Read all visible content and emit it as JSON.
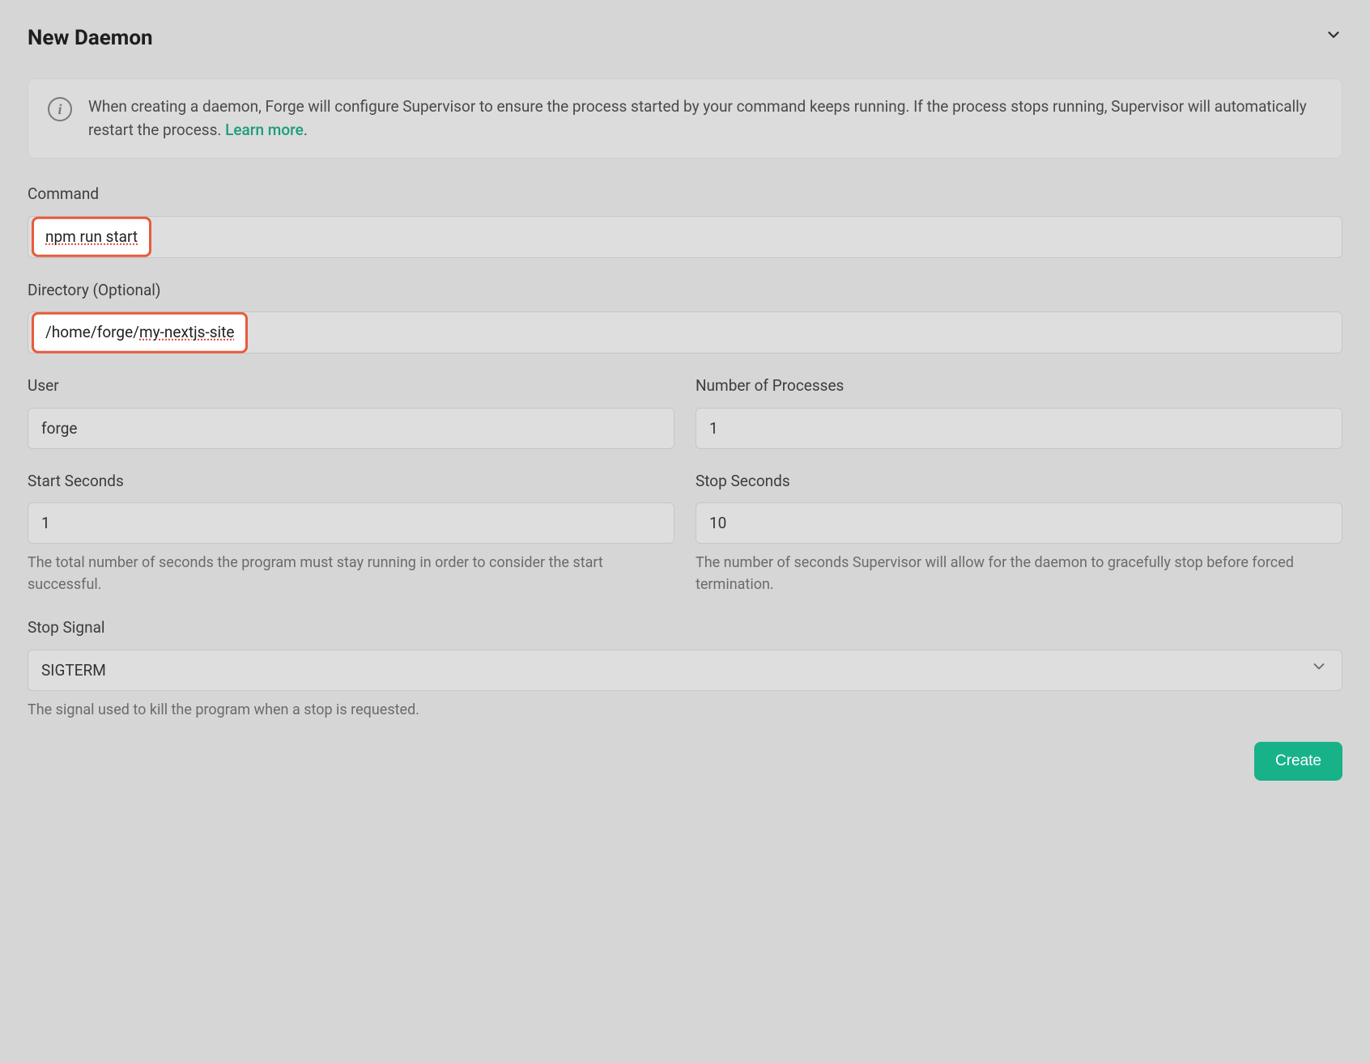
{
  "header": {
    "title": "New Daemon"
  },
  "info": {
    "text": "When creating a daemon, Forge will configure Supervisor to ensure the process started by your command keeps running. If the process stops running, Supervisor will automatically restart the process. ",
    "learn_more": "Learn more"
  },
  "fields": {
    "command": {
      "label": "Command",
      "value": "npm run start"
    },
    "directory": {
      "label": "Directory (Optional)",
      "value_prefix": "/home/forge/",
      "value_suffix": "my-nextjs-site"
    },
    "user": {
      "label": "User",
      "value": "forge"
    },
    "num_processes": {
      "label": "Number of Processes",
      "value": "1"
    },
    "start_seconds": {
      "label": "Start Seconds",
      "value": "1",
      "help": "The total number of seconds the program must stay running in order to consider the start successful."
    },
    "stop_seconds": {
      "label": "Stop Seconds",
      "value": "10",
      "help": "The number of seconds Supervisor will allow for the daemon to gracefully stop before forced termination."
    },
    "stop_signal": {
      "label": "Stop Signal",
      "value": "SIGTERM",
      "help": "The signal used to kill the program when a stop is requested."
    }
  },
  "buttons": {
    "create": "Create"
  }
}
